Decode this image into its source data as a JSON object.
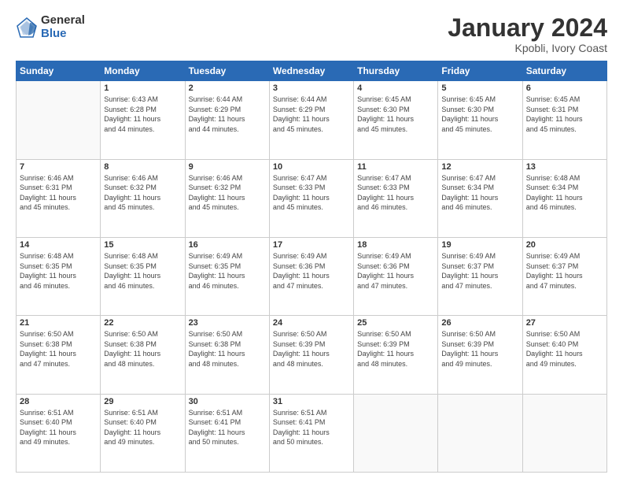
{
  "logo": {
    "general": "General",
    "blue": "Blue"
  },
  "title": "January 2024",
  "subtitle": "Kpobli, Ivory Coast",
  "days": [
    "Sunday",
    "Monday",
    "Tuesday",
    "Wednesday",
    "Thursday",
    "Friday",
    "Saturday"
  ],
  "weeks": [
    [
      {
        "day": "",
        "content": ""
      },
      {
        "day": "1",
        "content": "Sunrise: 6:43 AM\nSunset: 6:28 PM\nDaylight: 11 hours\nand 44 minutes."
      },
      {
        "day": "2",
        "content": "Sunrise: 6:44 AM\nSunset: 6:29 PM\nDaylight: 11 hours\nand 44 minutes."
      },
      {
        "day": "3",
        "content": "Sunrise: 6:44 AM\nSunset: 6:29 PM\nDaylight: 11 hours\nand 45 minutes."
      },
      {
        "day": "4",
        "content": "Sunrise: 6:45 AM\nSunset: 6:30 PM\nDaylight: 11 hours\nand 45 minutes."
      },
      {
        "day": "5",
        "content": "Sunrise: 6:45 AM\nSunset: 6:30 PM\nDaylight: 11 hours\nand 45 minutes."
      },
      {
        "day": "6",
        "content": "Sunrise: 6:45 AM\nSunset: 6:31 PM\nDaylight: 11 hours\nand 45 minutes."
      }
    ],
    [
      {
        "day": "7",
        "content": "Sunrise: 6:46 AM\nSunset: 6:31 PM\nDaylight: 11 hours\nand 45 minutes."
      },
      {
        "day": "8",
        "content": "Sunrise: 6:46 AM\nSunset: 6:32 PM\nDaylight: 11 hours\nand 45 minutes."
      },
      {
        "day": "9",
        "content": "Sunrise: 6:46 AM\nSunset: 6:32 PM\nDaylight: 11 hours\nand 45 minutes."
      },
      {
        "day": "10",
        "content": "Sunrise: 6:47 AM\nSunset: 6:33 PM\nDaylight: 11 hours\nand 45 minutes."
      },
      {
        "day": "11",
        "content": "Sunrise: 6:47 AM\nSunset: 6:33 PM\nDaylight: 11 hours\nand 46 minutes."
      },
      {
        "day": "12",
        "content": "Sunrise: 6:47 AM\nSunset: 6:34 PM\nDaylight: 11 hours\nand 46 minutes."
      },
      {
        "day": "13",
        "content": "Sunrise: 6:48 AM\nSunset: 6:34 PM\nDaylight: 11 hours\nand 46 minutes."
      }
    ],
    [
      {
        "day": "14",
        "content": "Sunrise: 6:48 AM\nSunset: 6:35 PM\nDaylight: 11 hours\nand 46 minutes."
      },
      {
        "day": "15",
        "content": "Sunrise: 6:48 AM\nSunset: 6:35 PM\nDaylight: 11 hours\nand 46 minutes."
      },
      {
        "day": "16",
        "content": "Sunrise: 6:49 AM\nSunset: 6:35 PM\nDaylight: 11 hours\nand 46 minutes."
      },
      {
        "day": "17",
        "content": "Sunrise: 6:49 AM\nSunset: 6:36 PM\nDaylight: 11 hours\nand 47 minutes."
      },
      {
        "day": "18",
        "content": "Sunrise: 6:49 AM\nSunset: 6:36 PM\nDaylight: 11 hours\nand 47 minutes."
      },
      {
        "day": "19",
        "content": "Sunrise: 6:49 AM\nSunset: 6:37 PM\nDaylight: 11 hours\nand 47 minutes."
      },
      {
        "day": "20",
        "content": "Sunrise: 6:49 AM\nSunset: 6:37 PM\nDaylight: 11 hours\nand 47 minutes."
      }
    ],
    [
      {
        "day": "21",
        "content": "Sunrise: 6:50 AM\nSunset: 6:38 PM\nDaylight: 11 hours\nand 47 minutes."
      },
      {
        "day": "22",
        "content": "Sunrise: 6:50 AM\nSunset: 6:38 PM\nDaylight: 11 hours\nand 48 minutes."
      },
      {
        "day": "23",
        "content": "Sunrise: 6:50 AM\nSunset: 6:38 PM\nDaylight: 11 hours\nand 48 minutes."
      },
      {
        "day": "24",
        "content": "Sunrise: 6:50 AM\nSunset: 6:39 PM\nDaylight: 11 hours\nand 48 minutes."
      },
      {
        "day": "25",
        "content": "Sunrise: 6:50 AM\nSunset: 6:39 PM\nDaylight: 11 hours\nand 48 minutes."
      },
      {
        "day": "26",
        "content": "Sunrise: 6:50 AM\nSunset: 6:39 PM\nDaylight: 11 hours\nand 49 minutes."
      },
      {
        "day": "27",
        "content": "Sunrise: 6:50 AM\nSunset: 6:40 PM\nDaylight: 11 hours\nand 49 minutes."
      }
    ],
    [
      {
        "day": "28",
        "content": "Sunrise: 6:51 AM\nSunset: 6:40 PM\nDaylight: 11 hours\nand 49 minutes."
      },
      {
        "day": "29",
        "content": "Sunrise: 6:51 AM\nSunset: 6:40 PM\nDaylight: 11 hours\nand 49 minutes."
      },
      {
        "day": "30",
        "content": "Sunrise: 6:51 AM\nSunset: 6:41 PM\nDaylight: 11 hours\nand 50 minutes."
      },
      {
        "day": "31",
        "content": "Sunrise: 6:51 AM\nSunset: 6:41 PM\nDaylight: 11 hours\nand 50 minutes."
      },
      {
        "day": "",
        "content": ""
      },
      {
        "day": "",
        "content": ""
      },
      {
        "day": "",
        "content": ""
      }
    ]
  ]
}
